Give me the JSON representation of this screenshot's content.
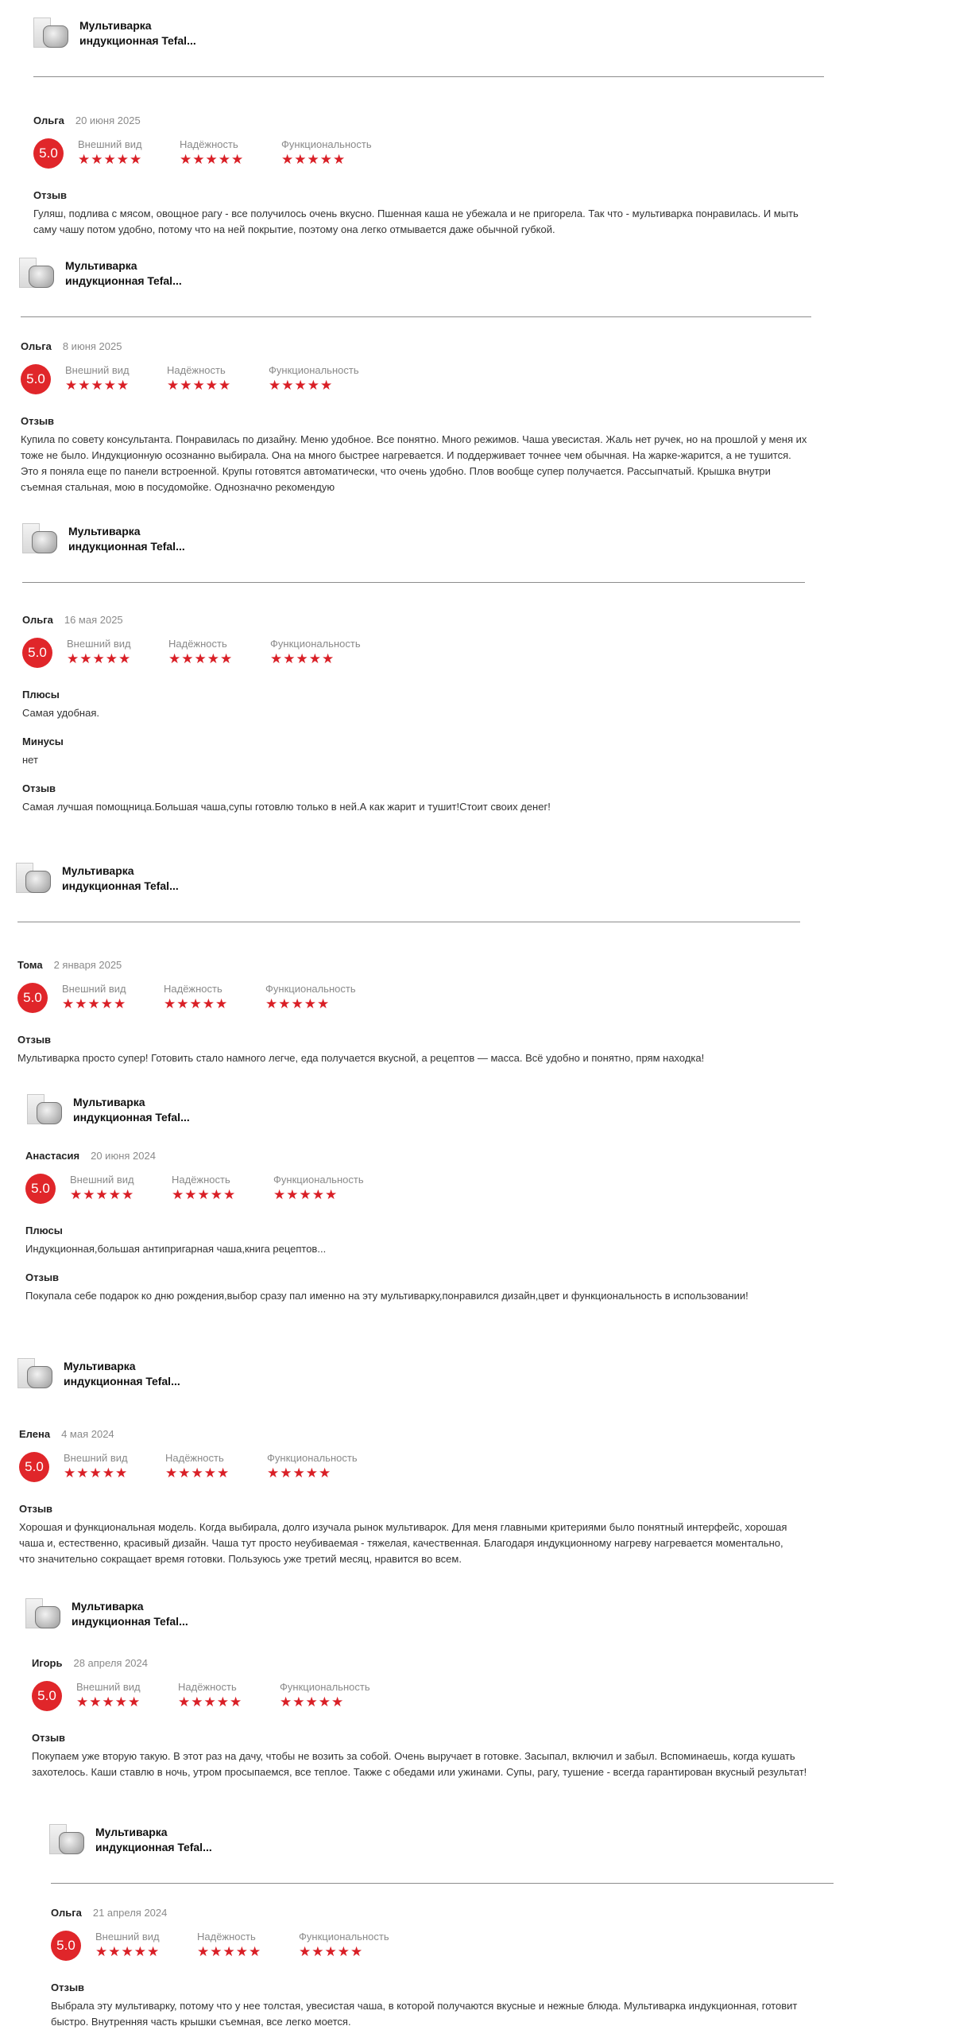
{
  "product_label": "Мультиварка индукционная Tefal...",
  "ratings": {
    "labels": [
      "Внешний вид",
      "Надёжность",
      "Функциональность"
    ],
    "stars": "★★★★★"
  },
  "colors": {
    "badge": "#e0262a",
    "stars": "#d91f26"
  },
  "reviews": [
    {
      "author": "Ольга",
      "date": "20 июня 2025",
      "score": "5.0",
      "sections": [
        {
          "title": "Отзыв",
          "text": "Гуляш, подлива с мясом, овощное рагу - все получилось очень вкусно. Пшенная каша не убежала и не пригорела. Так что - мультиварка понравилась. И мыть саму чашу потом удобно, потому что на ней покрытие, поэтому она легко отмывается даже обычной губкой."
        }
      ]
    },
    {
      "author": "Ольга",
      "date": "8 июня 2025",
      "score": "5.0",
      "sections": [
        {
          "title": "Отзыв",
          "text": "Купила по совету консультанта. Понравилась по дизайну. Меню удобное. Все понятно. Много режимов. Чаша увесистая. Жаль нет ручек, но на прошлой у меня их тоже не было. Индукционную осознанно выбирала. Она на много быстрее нагревается. И поддерживает точнее чем обычная. На жарке-жарится, а не тушится. Это я поняла еще по панели встроенной. Крупы готовятся автоматически, что очень удобно. Плов вообще супер получается. Рассыпчатый. Крышка внутри съемная стальная, мою в посудомойке. Однозначно рекомендую"
        }
      ]
    },
    {
      "author": "Ольга",
      "date": "16 мая 2025",
      "score": "5.0",
      "sections": [
        {
          "title": "Плюсы",
          "text": "Самая удобная."
        },
        {
          "title": "Минусы",
          "text": "нет"
        },
        {
          "title": "Отзыв",
          "text": "Самая лучшая помощница.Большая чаша,супы готовлю только в ней.А как жарит и тушит!Стоит своих денег!"
        }
      ]
    },
    {
      "author": "Тома",
      "date": "2 января 2025",
      "score": "5.0",
      "sections": [
        {
          "title": "Отзыв",
          "text": "Мультиварка просто супер! Готовить стало намного легче, еда получается вкусной, а рецептов — масса. Всё удобно и понятно, прям находка!"
        }
      ]
    },
    {
      "author": "Анастасия",
      "date": "20 июня 2024",
      "score": "5.0",
      "sections": [
        {
          "title": "Плюсы",
          "text": "Индукционная,большая антипригарная чаша,книга рецептов..."
        },
        {
          "title": "Отзыв",
          "text": "Покупала себе подарок ко дню рождения,выбор сразу пал именно на эту мультиварку,понравился дизайн,цвет и функциональность в использовании!"
        }
      ]
    },
    {
      "author": "Елена",
      "date": "4 мая 2024",
      "score": "5.0",
      "sections": [
        {
          "title": "Отзыв",
          "text": "Хорошая и функциональная модель. Когда выбирала, долго изучала рынок мультиварок. Для меня главными критериями было понятный интерфейс, хорошая чаша и, естественно, красивый дизайн. Чаша тут просто неубиваемая - тяжелая, качественная. Благодаря индукционному нагреву нагревается моментально, что значительно сокращает время готовки. Пользуюсь уже третий месяц, нравится во всем."
        }
      ]
    },
    {
      "author": "Игорь",
      "date": "28 апреля 2024",
      "score": "5.0",
      "sections": [
        {
          "title": "Отзыв",
          "text": "Покупаем уже вторую такую. В этот раз на дачу, чтобы не возить за собой. Очень выручает в готовке. Засыпал, включил и забыл. Вспоминаешь, когда кушать захотелось. Каши ставлю в ночь, утром просыпаемся, все теплое. Также с обедами или ужинами. Супы, рагу, тушение - всегда гарантирован вкусный результат!"
        }
      ]
    },
    {
      "author": "Ольга",
      "date": "21 апреля 2024",
      "score": "5.0",
      "sections": [
        {
          "title": "Отзыв",
          "text": "Выбрала эту мультиварку, потому что у нее толстая, увесистая чаша, в которой получаются вкусные и нежные блюда. Мультиварка индукционная, готовит быстро. Внутренняя часть крышки съемная, все легко моется."
        }
      ]
    }
  ]
}
